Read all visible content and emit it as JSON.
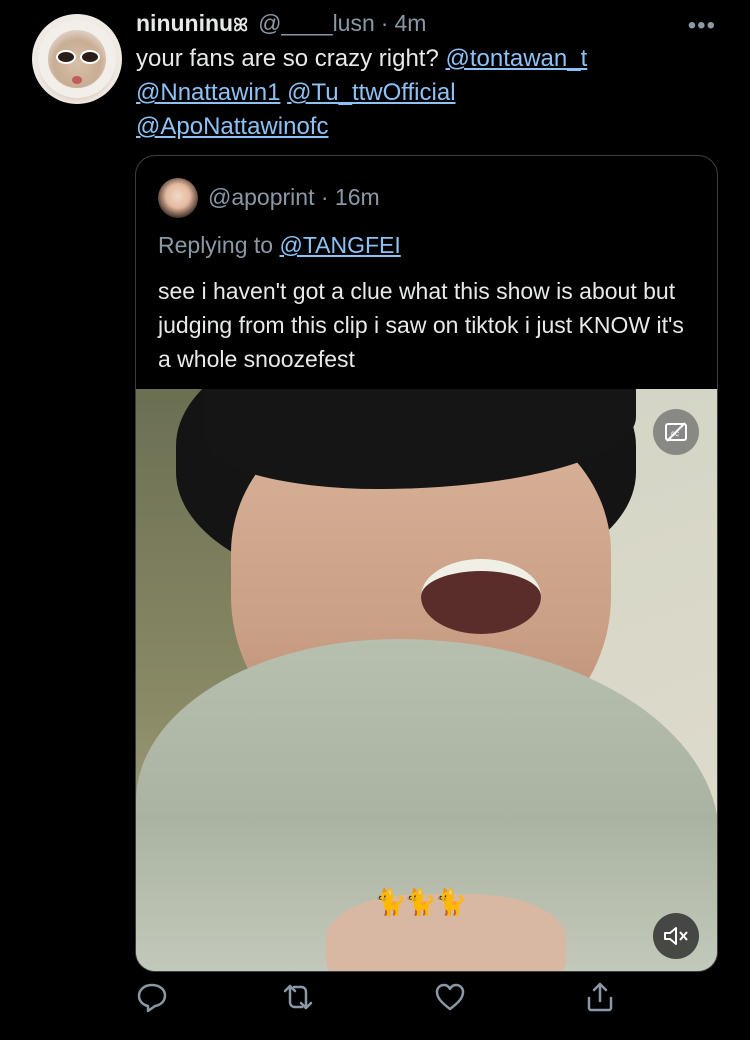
{
  "tweet": {
    "author_name": "ninuninu",
    "author_name_suffix": "ꕤ",
    "handle": "@____lusn",
    "separator": "·",
    "time": "4m",
    "more_label": "•••",
    "text_intro": "your fans are so crazy right? ",
    "mentions": [
      "@tontawan_t",
      "@Nnattawin1",
      "@Tu_ttwOfficial",
      "@ApoNattawinofc"
    ]
  },
  "quoted_tweet": {
    "handle": "@apoprint",
    "separator": "·",
    "time": "16m",
    "replying_prefix": "Replying to ",
    "replying_to": "@TANGFEI",
    "text": "see i haven't got a clue what this show is about but judging from this clip i saw on tiktok i just KNOW it's a whole snoozefest",
    "media_caption_emojis": "🐈🐈🐈"
  },
  "media_controls": {
    "captions_icon": "closed-captions-off-icon",
    "mute_icon": "speaker-muted-icon"
  },
  "actions": [
    "reply-icon",
    "retweet-icon",
    "like-icon",
    "share-icon"
  ],
  "colors": {
    "background": "#000000",
    "text": "#e7e9ea",
    "secondary": "#8b98a5",
    "link": "#8ec2f5",
    "border": "#3a3f44"
  }
}
